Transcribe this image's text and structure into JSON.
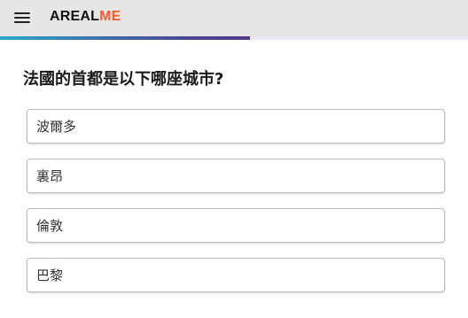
{
  "header": {
    "logo_main": "AREAL",
    "logo_accent": "ME",
    "accent_color": "#ff5a2b",
    "menu_icon": "hamburger-menu-icon"
  },
  "progress": {
    "fraction": 0.535
  },
  "quiz": {
    "question": "法國的首都是以下哪座城市?",
    "options": [
      {
        "label": "波爾多"
      },
      {
        "label": "裏昂"
      },
      {
        "label": "倫敦"
      },
      {
        "label": "巴黎"
      }
    ]
  }
}
